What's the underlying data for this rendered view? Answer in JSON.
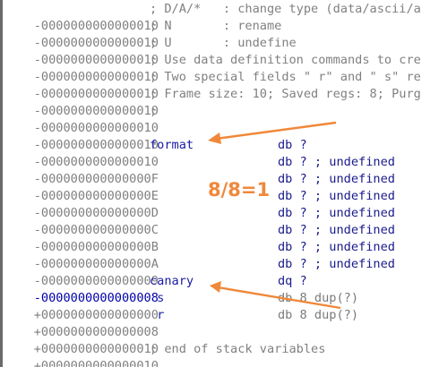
{
  "lines": [
    {
      "offset": "-0000000000000010",
      "comment": "; D/A/*   : change type (data/ascii/a"
    },
    {
      "offset": "-0000000000000010",
      "comment": "; N       : rename"
    },
    {
      "offset": "-0000000000000010",
      "comment": "; U       : undefine"
    },
    {
      "offset": "-0000000000000010",
      "comment": "; Use data definition commands to cre"
    },
    {
      "offset": "-0000000000000010",
      "comment": "; Two special fields \" r\" and \" s\" re"
    },
    {
      "offset": "-0000000000000010",
      "comment": "; Frame size: 10; Saved regs: 8; Purg"
    },
    {
      "offset": "-0000000000000010",
      "comment": ";"
    },
    {
      "offset": "-0000000000000010",
      "comment": ""
    },
    {
      "offset": "-0000000000000010",
      "name": "format",
      "directive": "db ?"
    },
    {
      "offset": "-000000000000000F",
      "directive": "db ? ; undefined"
    },
    {
      "offset": "-000000000000000E",
      "directive": "db ? ; undefined"
    },
    {
      "offset": "-000000000000000D",
      "directive": "db ? ; undefined"
    },
    {
      "offset": "-000000000000000C",
      "directive": "db ? ; undefined"
    },
    {
      "offset": "-000000000000000B",
      "directive": "db ? ; undefined"
    },
    {
      "offset": "-000000000000000A",
      "directive": "db ? ; undefined"
    },
    {
      "offset": "-0000000000000009",
      "directive": "db ? ; undefined"
    },
    {
      "offset": "-0000000000000008",
      "name": "canary",
      "directive": "dq ?"
    },
    {
      "offset": "+0000000000000000",
      "name": " s",
      "directive": "db 8 dup(?)"
    },
    {
      "offset": "+0000000000000008",
      "name": " r",
      "directive": "db 8 dup(?)"
    },
    {
      "offset": "+0000000000000010",
      "comment": ""
    },
    {
      "offset": "+0000000000000010",
      "comment": "; end of stack variables"
    }
  ],
  "annotation": "8/8=1",
  "colors": {
    "arrow": "#f0883a",
    "name": "#1a1aa6",
    "offset": "#808080",
    "highlight_offset": "#0000aa"
  }
}
